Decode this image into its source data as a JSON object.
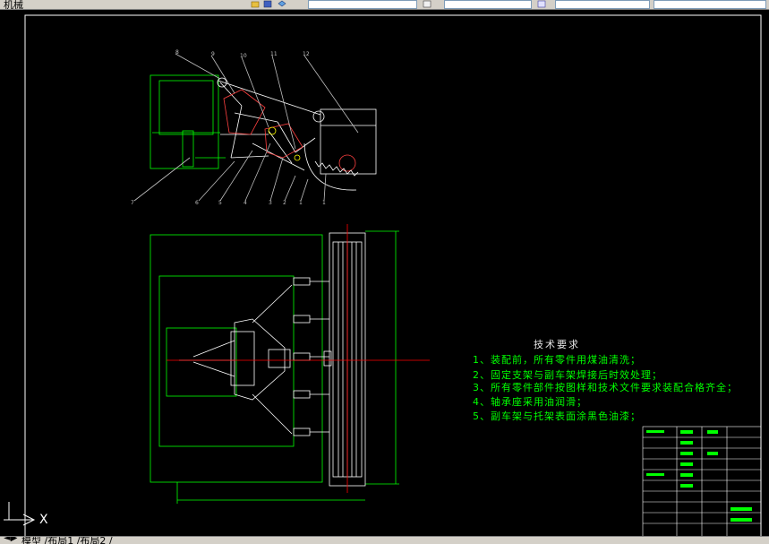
{
  "window": {
    "toolbar_text": "机械",
    "layout_tabs": "模型 /布局1 /布局2 /"
  },
  "icons": [
    "open-icon",
    "save-icon",
    "layer-icon",
    "properties-icon",
    "ucs-icon"
  ],
  "drawing": {
    "tech_requirements_title": "技术要求",
    "tech_requirements": [
      "1、装配前，所有零件用煤油清洗；",
      "2、固定支架与副车架焊接后时效处理；",
      "3、所有零件部件按图样和技术文件要求装配合格齐全；",
      "4、轴承座采用油润滑；",
      "5、副车架与托架表面涂黑色油漆；"
    ],
    "callouts_top": [
      "8",
      "9",
      "10",
      "11",
      "12"
    ],
    "callouts_bottom": [
      "7",
      "6",
      "5",
      "4",
      "3",
      "2",
      "1"
    ],
    "ucs_axis_label": "X"
  },
  "colors": {
    "background": "#000000",
    "frame": "#ffffff",
    "geometry": "#ffffff",
    "annotation": "#00ff00",
    "leaders": "#c0c0c0",
    "axis": "#ff0000"
  }
}
